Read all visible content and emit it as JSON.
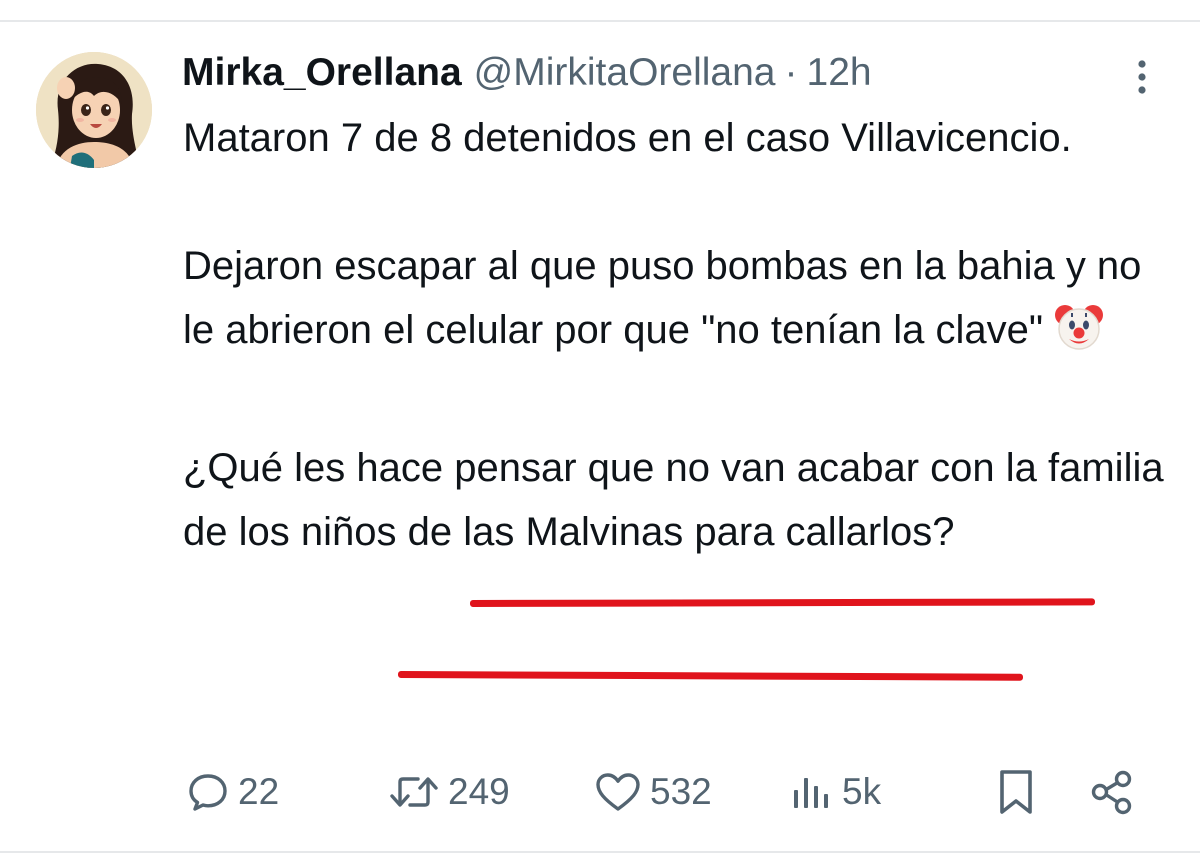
{
  "tweet": {
    "author": {
      "display_name": "Mirka_Orellana",
      "handle": "@MirkitaOrellana",
      "separator": "·",
      "time": "12h"
    },
    "paragraphs": [
      "Mataron 7 de 8 detenidos en el caso Villavicencio.",
      "Dejaron escapar al que puso bombas en la bahia y no le abrieron el celular por que \"no tenían la clave\"",
      "¿Qué les hace pensar que no van acabar con la familia de los niños de las Malvinas para callarlos?"
    ],
    "emoji": "clown-face-emoji",
    "annotation_color": "#e0141c",
    "actions": {
      "replies": "22",
      "retweets": "249",
      "likes": "532",
      "views": "5k"
    }
  },
  "icons": {
    "more": "more-vertical-icon",
    "reply": "comment-icon",
    "retweet": "retweet-icon",
    "like": "heart-icon",
    "views": "bar-chart-icon",
    "bookmark": "bookmark-icon",
    "share": "share-icon"
  },
  "colors": {
    "text": "#0f1419",
    "secondary": "#536471",
    "divider": "#e6e8ea"
  }
}
